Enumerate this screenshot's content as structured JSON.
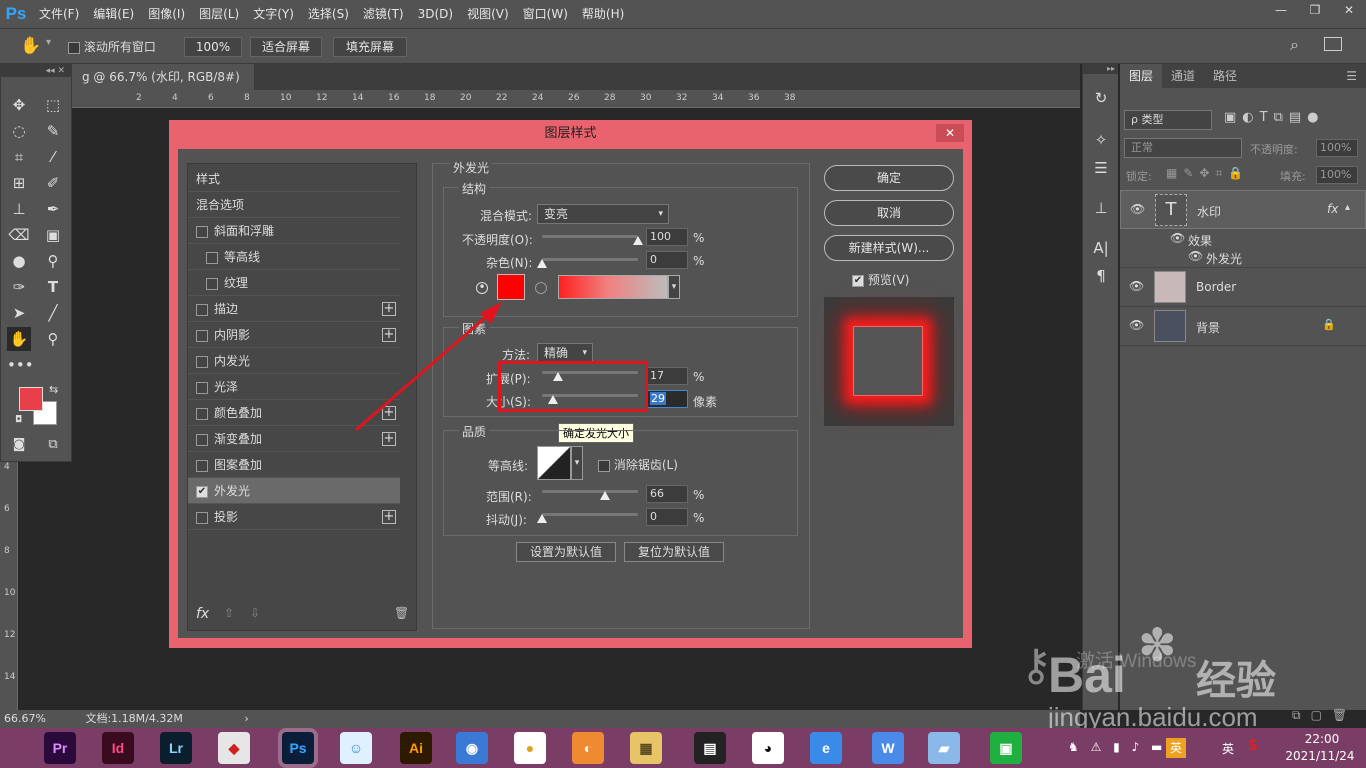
{
  "app": {
    "logo": "Ps",
    "menu": [
      "文件(F)",
      "编辑(E)",
      "图像(I)",
      "图层(L)",
      "文字(Y)",
      "选择(S)",
      "滤镜(T)",
      "3D(D)",
      "视图(V)",
      "窗口(W)",
      "帮助(H)"
    ],
    "win_controls": [
      "—",
      "❐",
      "✕"
    ]
  },
  "options": {
    "scroll_all_label": "滚动所有窗口",
    "zoom_value": "100%",
    "fit_screen": "适合屏幕",
    "fill_screen": "填充屏幕"
  },
  "doc": {
    "tab_title": "g @ 66.7% (水印, RGB/8#) *",
    "zoom": "66.67%",
    "doc_info": "文档:1.18M/4.32M",
    "ruler_h": [
      "2",
      "4",
      "6",
      "8",
      "10",
      "12",
      "14",
      "16",
      "18",
      "20",
      "22",
      "24",
      "26",
      "28",
      "30",
      "32",
      "34",
      "36",
      "38"
    ],
    "ruler_v": [
      "2",
      "4",
      "6",
      "8",
      "10",
      "12",
      "14"
    ]
  },
  "dialog": {
    "title": "图层样式",
    "close": "✕",
    "styles_list": [
      {
        "label": "样式",
        "check": false,
        "hascheck": false,
        "plus": false,
        "indent": false,
        "selected": false
      },
      {
        "label": "混合选项",
        "check": false,
        "hascheck": false,
        "plus": false,
        "indent": false,
        "selected": false
      },
      {
        "label": "斜面和浮雕",
        "check": false,
        "hascheck": true,
        "plus": false,
        "indent": false,
        "selected": false
      },
      {
        "label": "等高线",
        "check": false,
        "hascheck": true,
        "plus": false,
        "indent": true,
        "selected": false
      },
      {
        "label": "纹理",
        "check": false,
        "hascheck": true,
        "plus": false,
        "indent": true,
        "selected": false
      },
      {
        "label": "描边",
        "check": false,
        "hascheck": true,
        "plus": true,
        "indent": false,
        "selected": false
      },
      {
        "label": "内阴影",
        "check": false,
        "hascheck": true,
        "plus": true,
        "indent": false,
        "selected": false
      },
      {
        "label": "内发光",
        "check": false,
        "hascheck": true,
        "plus": false,
        "indent": false,
        "selected": false
      },
      {
        "label": "光泽",
        "check": false,
        "hascheck": true,
        "plus": false,
        "indent": false,
        "selected": false
      },
      {
        "label": "颜色叠加",
        "check": false,
        "hascheck": true,
        "plus": true,
        "indent": false,
        "selected": false
      },
      {
        "label": "渐变叠加",
        "check": false,
        "hascheck": true,
        "plus": true,
        "indent": false,
        "selected": false
      },
      {
        "label": "图案叠加",
        "check": false,
        "hascheck": true,
        "plus": false,
        "indent": false,
        "selected": false
      },
      {
        "label": "外发光",
        "check": true,
        "hascheck": true,
        "plus": false,
        "indent": false,
        "selected": true
      },
      {
        "label": "投影",
        "check": false,
        "hascheck": true,
        "plus": true,
        "indent": false,
        "selected": false
      }
    ],
    "fx": "fx",
    "section_title": "外发光",
    "structure": {
      "title": "结构",
      "blend_label": "混合模式:",
      "blend_value": "变亮",
      "opacity_label": "不透明度(O):",
      "opacity_value": "100",
      "opacity_level": 1.0,
      "noise_label": "杂色(N):",
      "noise_value": "0",
      "noise_level": 0.0,
      "percent": "%",
      "glow_color": "#ff0000"
    },
    "elements": {
      "title": "图素",
      "method_label": "方法:",
      "method_value": "精确",
      "spread_label": "扩展(P):",
      "spread_value": "17",
      "spread_level": 0.17,
      "size_label": "大小(S):",
      "size_value": "29",
      "size_level": 0.116,
      "px_unit": "像素"
    },
    "quality": {
      "title": "品质",
      "contour_label": "等高线:",
      "antialias_label": "消除锯齿(L)",
      "range_label": "范围(R):",
      "range_value": "66",
      "range_level": 0.66,
      "jitter_label": "抖动(J):",
      "jitter_value": "0",
      "jitter_level": 0.0
    },
    "set_default": "设置为默认值",
    "reset_default": "复位为默认值",
    "tooltip": "确定发光大小",
    "ok": "确定",
    "cancel": "取消",
    "new_style": "新建样式(W)...",
    "preview_label": "预览(V)",
    "highlight_color": "#e0141e"
  },
  "layers_panel": {
    "tabs": [
      "图层",
      "通道",
      "路径"
    ],
    "kind_label": "ρ 类型",
    "blend_mode": "正常",
    "opacity_label": "不透明度:",
    "opacity_value": "100%",
    "lock_label": "锁定:",
    "fill_label": "填充:",
    "fill_value": "100%",
    "layers": [
      {
        "name": "水印",
        "type": "text",
        "fx": "fx"
      },
      {
        "name": "Border",
        "type": "image",
        "fx": ""
      },
      {
        "name": "背景",
        "type": "image",
        "fx": "",
        "locked": true
      }
    ],
    "effects_label": "效果",
    "effect_item": "外发光"
  },
  "watermark": {
    "activate": "激活 Windows",
    "baidu": "Bai",
    "jingyan": "经验",
    "url": "jingyan.baidu.com"
  },
  "taskbar": {
    "apps": [
      {
        "label": "Pr",
        "bg": "#2a0a3a",
        "fg": "#e08aff"
      },
      {
        "label": "Id",
        "bg": "#3a0a1e",
        "fg": "#ff4a8a"
      },
      {
        "label": "Lr",
        "bg": "#0a1e2e",
        "fg": "#8ad4ff"
      },
      {
        "label": "◆",
        "bg": "#e6e6e6",
        "fg": "#d02020"
      },
      {
        "label": "Ps",
        "bg": "#0a1e3a",
        "fg": "#31a8ff"
      },
      {
        "label": "☺",
        "bg": "#dff0ff",
        "fg": "#3a8ad4"
      },
      {
        "label": "Ai",
        "bg": "#2e1a00",
        "fg": "#ff9a00"
      },
      {
        "label": "◉",
        "bg": "#3a7ad4",
        "fg": "#ffffff"
      },
      {
        "label": "●",
        "bg": "#ffffff",
        "fg": "#e0a020"
      },
      {
        "label": "◐",
        "bg": "#f08a30",
        "fg": "#ffffff"
      },
      {
        "label": "▦",
        "bg": "#e8c468",
        "fg": "#5a4a20"
      },
      {
        "label": "▤",
        "bg": "#222222",
        "fg": "#ffffff"
      },
      {
        "label": "◕",
        "bg": "#ffffff",
        "fg": "#111111"
      },
      {
        "label": "e",
        "bg": "#3a8ae8",
        "fg": "#ffffff"
      },
      {
        "label": "W",
        "bg": "#4a8ae8",
        "fg": "#ffffff"
      },
      {
        "label": "▰",
        "bg": "#8ab8e8",
        "fg": "#ffffff"
      },
      {
        "label": "▣",
        "bg": "#20b040",
        "fg": "#ffffff"
      }
    ],
    "tray_lang": "英",
    "tray_ime": "英",
    "time": "22:00",
    "date": "2021/11/24"
  }
}
